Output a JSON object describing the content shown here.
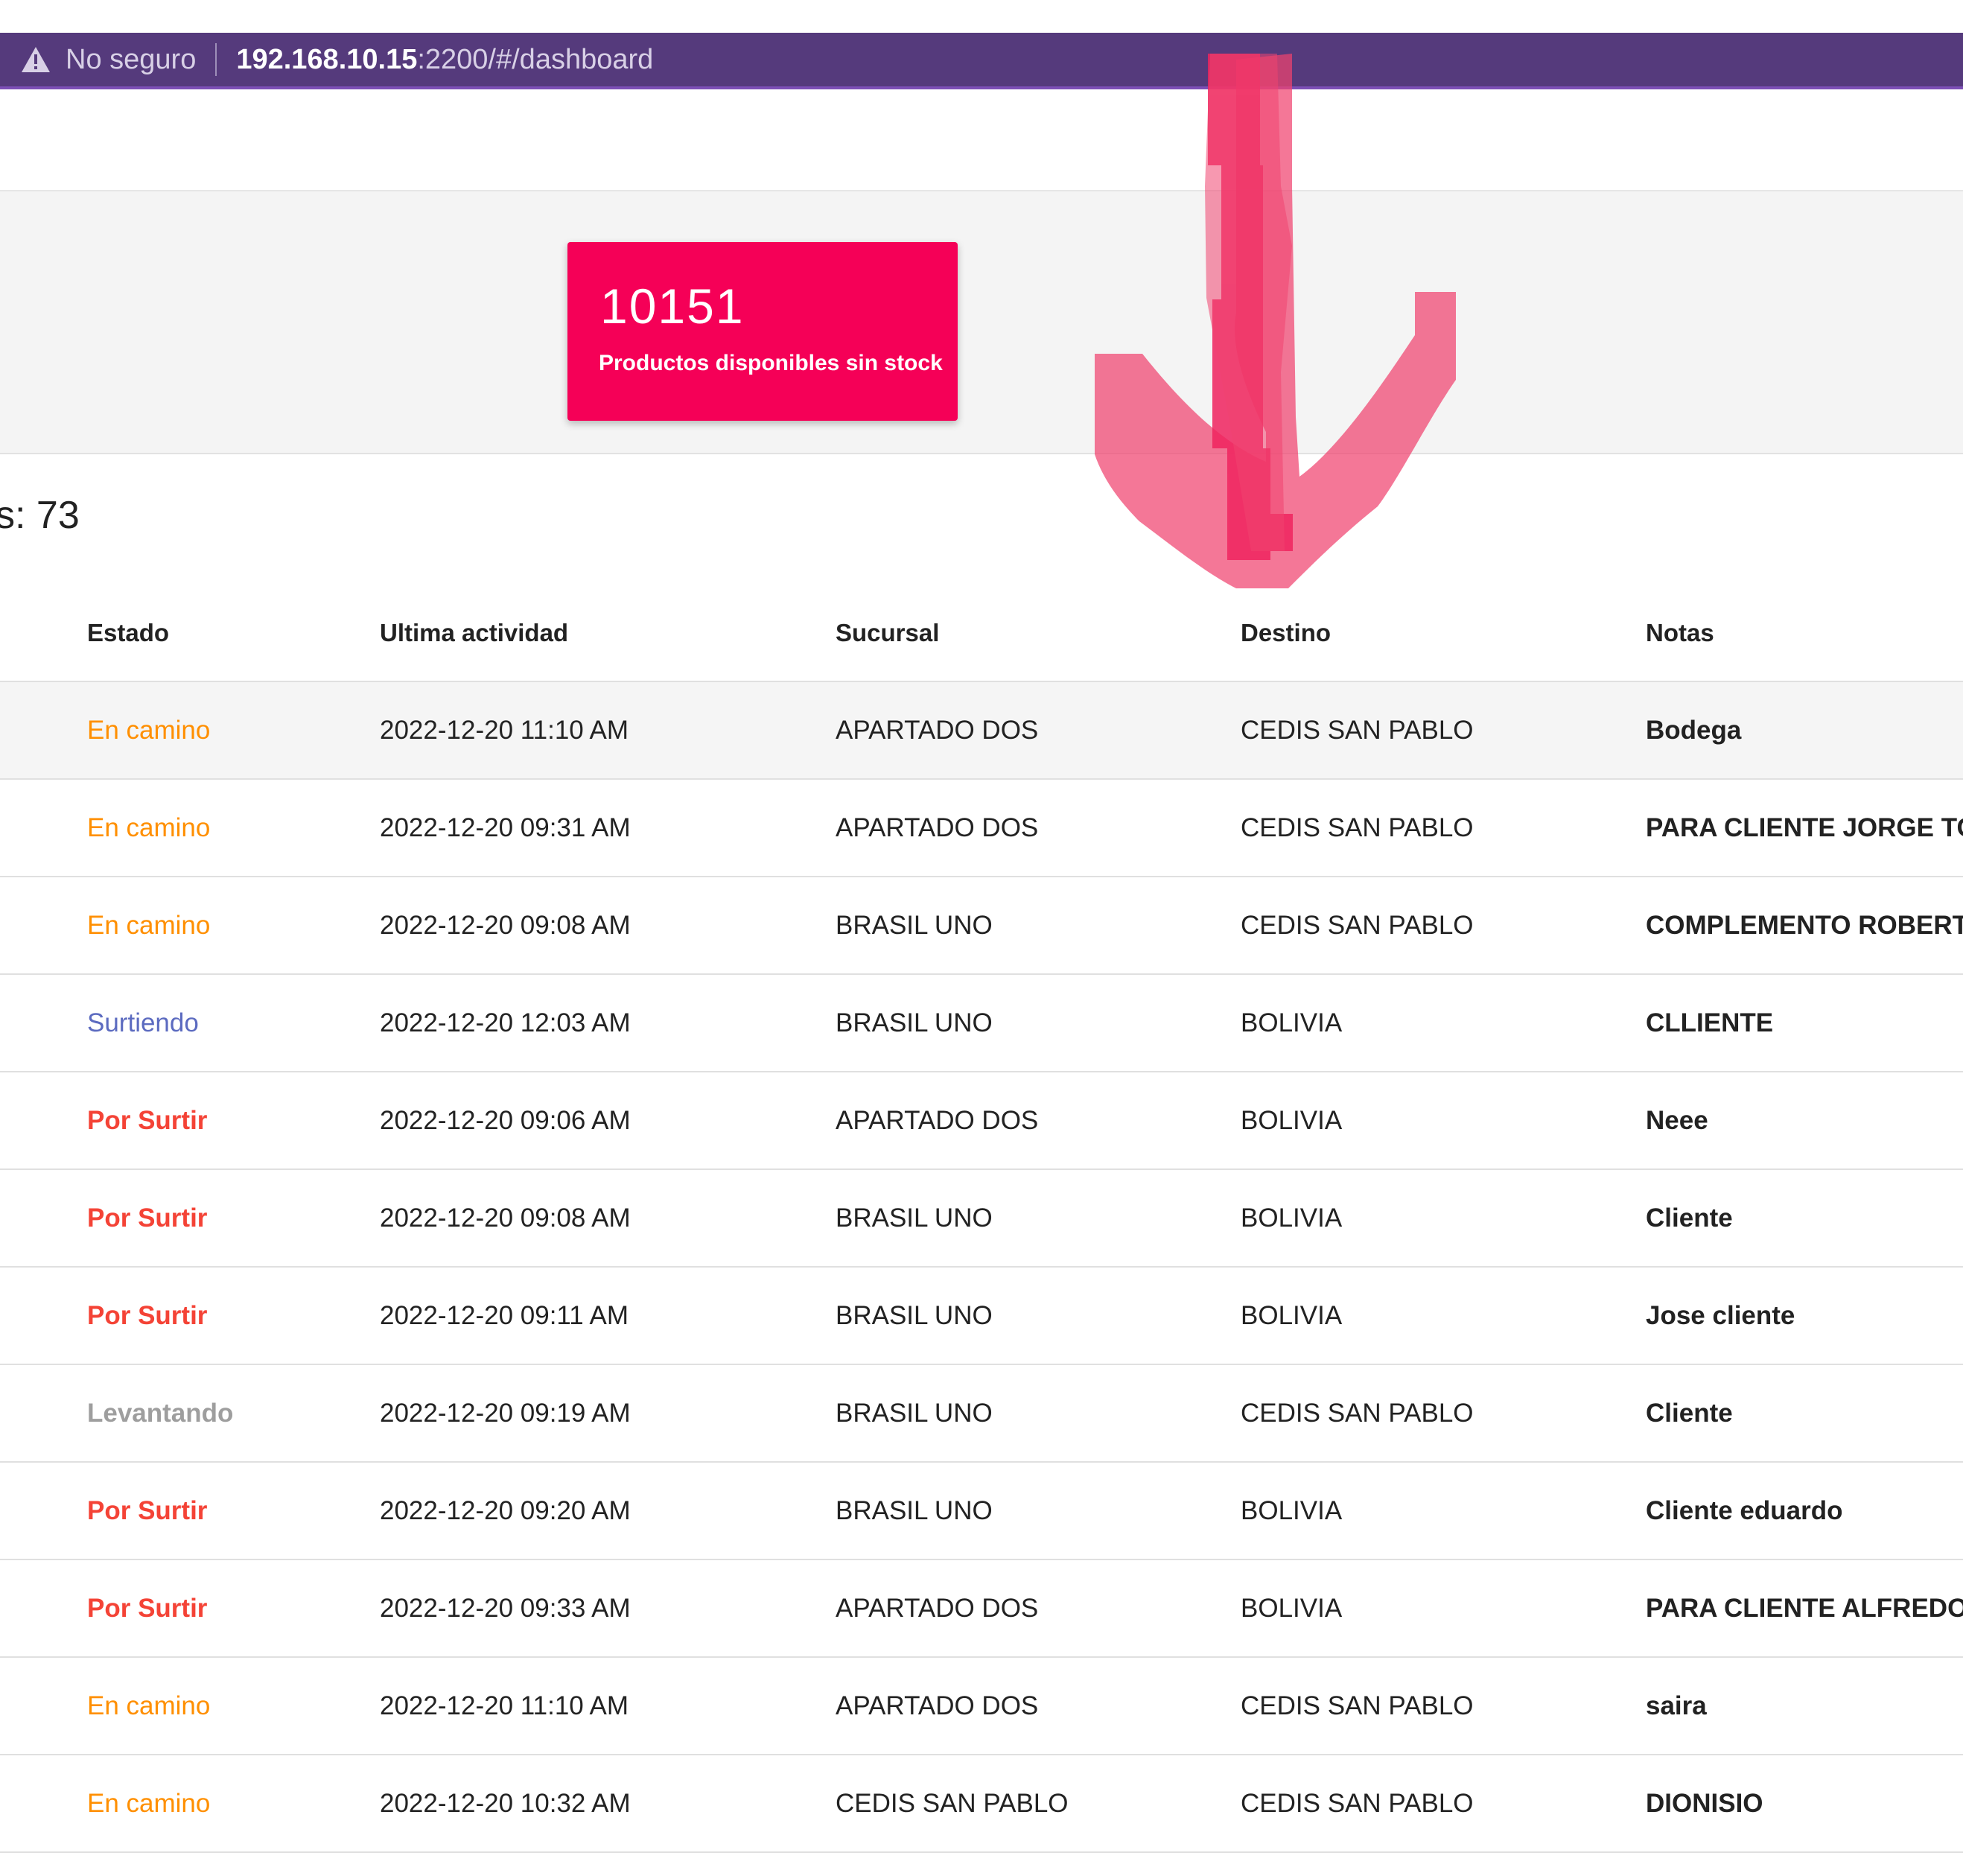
{
  "browser": {
    "security_label": "No seguro",
    "url_host": "192.168.10.15",
    "url_path": ":2200/#/dashboard"
  },
  "stat_card": {
    "value": "10151",
    "label": "Productos disponibles sin stock",
    "color": "#f50057"
  },
  "count_text": "s: 73",
  "table": {
    "headers": [
      "Estado",
      "Ultima actividad",
      "Sucursal",
      "Destino",
      "Notas"
    ],
    "rows": [
      {
        "estado": "En camino",
        "fecha": "2022-12-20 11:10 AM",
        "sucursal": "APARTADO DOS",
        "destino": "CEDIS SAN PABLO",
        "notas": "Bodega"
      },
      {
        "estado": "En camino",
        "fecha": "2022-12-20 09:31 AM",
        "sucursal": "APARTADO DOS",
        "destino": "CEDIS SAN PABLO",
        "notas": "PARA CLIENTE JORGE TON"
      },
      {
        "estado": "En camino",
        "fecha": "2022-12-20 09:08 AM",
        "sucursal": "BRASIL UNO",
        "destino": "CEDIS SAN PABLO",
        "notas": "COMPLEMENTO ROBERTO"
      },
      {
        "estado": "Surtiendo",
        "fecha": "2022-12-20 12:03 AM",
        "sucursal": "BRASIL UNO",
        "destino": "BOLIVIA",
        "notas": "CLLIENTE"
      },
      {
        "estado": "Por Surtir",
        "fecha": "2022-12-20 09:06 AM",
        "sucursal": "APARTADO DOS",
        "destino": "BOLIVIA",
        "notas": "Neee"
      },
      {
        "estado": "Por Surtir",
        "fecha": "2022-12-20 09:08 AM",
        "sucursal": "BRASIL UNO",
        "destino": "BOLIVIA",
        "notas": "Cliente"
      },
      {
        "estado": "Por Surtir",
        "fecha": "2022-12-20 09:11 AM",
        "sucursal": "BRASIL UNO",
        "destino": "BOLIVIA",
        "notas": "Jose cliente"
      },
      {
        "estado": "Levantando",
        "fecha": "2022-12-20 09:19 AM",
        "sucursal": "BRASIL UNO",
        "destino": "CEDIS SAN PABLO",
        "notas": "Cliente"
      },
      {
        "estado": "Por Surtir",
        "fecha": "2022-12-20 09:20 AM",
        "sucursal": "BRASIL UNO",
        "destino": "BOLIVIA",
        "notas": "Cliente eduardo"
      },
      {
        "estado": "Por Surtir",
        "fecha": "2022-12-20 09:33 AM",
        "sucursal": "APARTADO DOS",
        "destino": "BOLIVIA",
        "notas": "PARA CLIENTE ALFREDO P"
      },
      {
        "estado": "En camino",
        "fecha": "2022-12-20 11:10 AM",
        "sucursal": "APARTADO DOS",
        "destino": "CEDIS SAN PABLO",
        "notas": "saira"
      },
      {
        "estado": "En camino",
        "fecha": "2022-12-20 10:32 AM",
        "sucursal": "CEDIS SAN PABLO",
        "destino": "CEDIS SAN PABLO",
        "notas": "DIONISIO"
      }
    ]
  },
  "status_colors": {
    "En camino": "#ff8f00",
    "Surtiendo": "#5c6bc0",
    "Por Surtir": "#f44336",
    "Levantando": "#9e9e9e"
  },
  "annotation": {
    "icon": "down-arrow-icon",
    "color": "#f0436f"
  }
}
